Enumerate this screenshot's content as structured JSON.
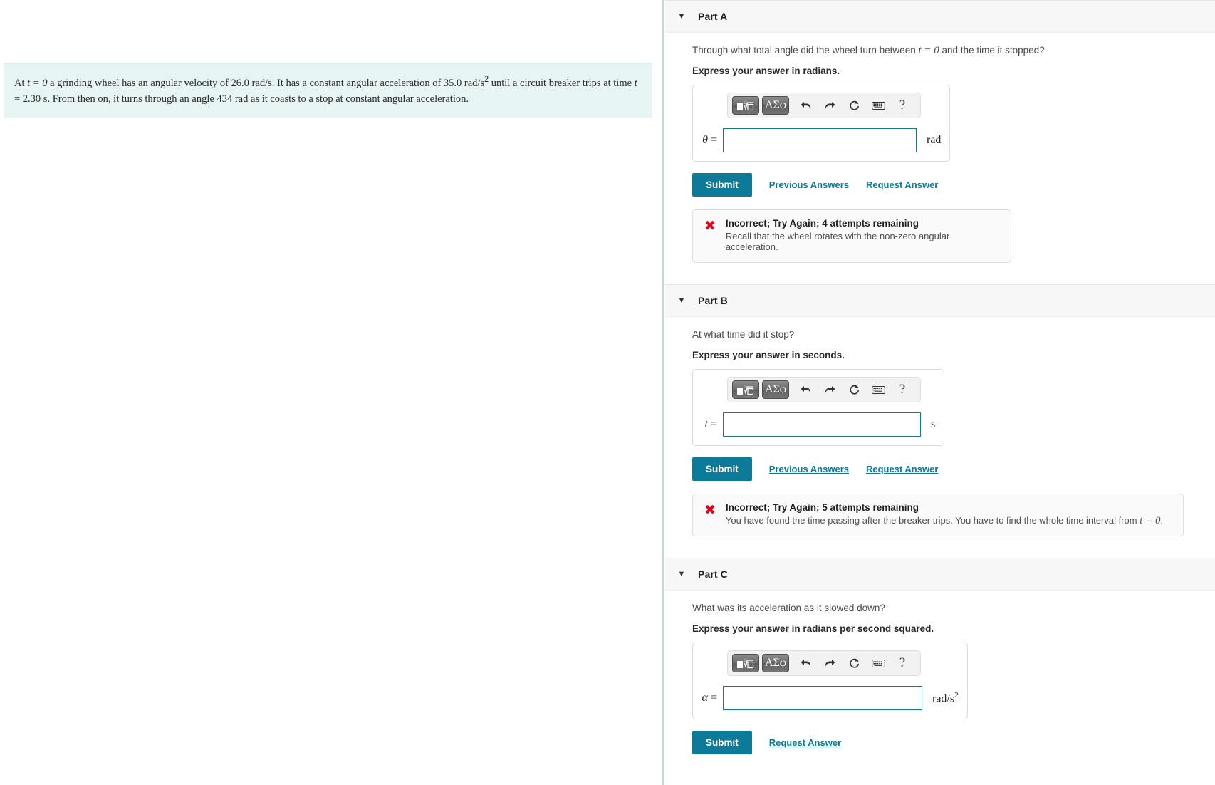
{
  "problem": {
    "segments": [
      {
        "t": "At ",
        "k": "plain"
      },
      {
        "t": "t = 0",
        "k": "math"
      },
      {
        "t": " a grinding wheel has an angular velocity of 26.0 ",
        "k": "plain"
      },
      {
        "t": "rad/s",
        "k": "mathr"
      },
      {
        "t": ". It has a constant angular acceleration of 35.0 ",
        "k": "plain"
      },
      {
        "t": "rad/s²",
        "k": "mathr"
      },
      {
        "t": " until a circuit breaker trips at time ",
        "k": "plain"
      },
      {
        "t": "t",
        "k": "math"
      },
      {
        "t": " = 2.30 s. From then on, it turns through an angle 434 ",
        "k": "plain"
      },
      {
        "t": "rad",
        "k": "mathr"
      },
      {
        "t": " as it coasts to a stop at constant angular acceleration.",
        "k": "plain"
      }
    ],
    "line1_pre": "At",
    "math_t0": "t = 0",
    "line1_mid": "a grinding wheel has an angular velocity of 26.0",
    "unit_rads": "rad/s",
    "line1_mid2": ". It has a constant angular acceleration of 35.0",
    "unit_rads2": "rad/s",
    "exp2": "2",
    "line1_end": "until a circuit breaker trips at time",
    "math_t": "t",
    "line2_mid": "= 2.30 s. From then on, it turns through an angle 434",
    "unit_rad": "rad",
    "line2_end": "as it coasts to a stop at constant angular acceleration."
  },
  "toolbar": {
    "template_button": "template-insert",
    "greek_button": "ΑΣφ",
    "undo": "undo",
    "redo": "redo",
    "reset": "reset",
    "keyboard": "keyboard",
    "help": "?"
  },
  "actions": {
    "submit_label": "Submit",
    "previous_answers_label": "Previous Answers",
    "request_answer_label": "Request Answer"
  },
  "colors": {
    "accent_teal": "#0b7b99",
    "input_border": "#14788f",
    "error_red": "#e0001b",
    "problem_bg": "#e6f4f3",
    "header_bg": "#f7f7f7"
  },
  "parts": [
    {
      "id": "A",
      "title": "Part A",
      "caret": "▼",
      "question_pre": "Through what total angle did the wheel turn between",
      "question_math": "t = 0",
      "question_post": "and the time it stopped?",
      "express": "Express your answer in radians.",
      "var_symbol": "θ",
      "equals": "=",
      "input_value": "",
      "units": "rad",
      "units_sup": "",
      "show_previous_answers": true,
      "feedback": {
        "icon": "✖",
        "title": "Incorrect; Try Again; 4 attempts remaining",
        "detail_pre": "Recall that the wheel rotates with the non-zero angular acceleration.",
        "detail_math": "",
        "detail_post": ""
      }
    },
    {
      "id": "B",
      "title": "Part B",
      "caret": "▼",
      "question_pre": "At what time did it stop?",
      "question_math": "",
      "question_post": "",
      "express": "Express your answer in seconds.",
      "var_symbol": "t",
      "equals": "=",
      "input_value": "",
      "units": "s",
      "units_sup": "",
      "show_previous_answers": true,
      "feedback": {
        "icon": "✖",
        "title": "Incorrect; Try Again; 5 attempts remaining",
        "detail_pre": "You have found the time passing after the breaker trips. You have to find the whole time interval from",
        "detail_math": "t = 0",
        "detail_post": "."
      }
    },
    {
      "id": "C",
      "title": "Part C",
      "caret": "▼",
      "question_pre": "What was its acceleration as it slowed down?",
      "question_math": "",
      "question_post": "",
      "express": "Express your answer in radians per second squared.",
      "var_symbol": "α",
      "equals": "=",
      "input_value": "",
      "units": "rad/s",
      "units_sup": "2",
      "show_previous_answers": false,
      "feedback": null
    }
  ]
}
